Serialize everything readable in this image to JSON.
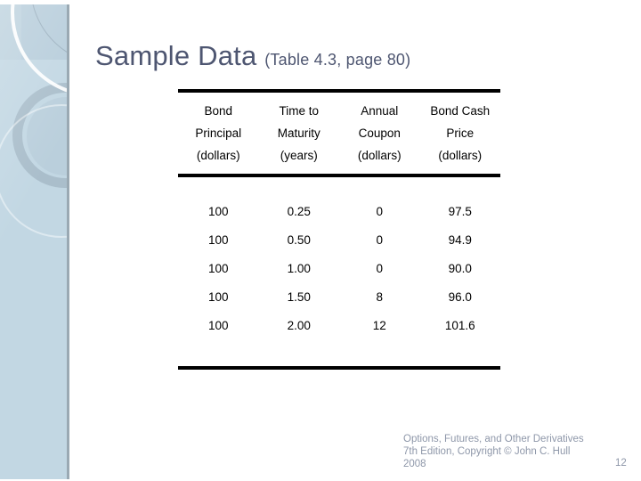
{
  "slide": {
    "title_main": "Sample Data ",
    "title_sub": "(Table 4.3, page 80)",
    "title_color": "#4e5671",
    "accent_sidebar_color": "#c2d7e3",
    "sidebar_border_color": "#9aa9b3"
  },
  "table": {
    "headers": [
      {
        "line1": "Bond",
        "line2": "Principal",
        "line3": "(dollars)"
      },
      {
        "line1": "Time to",
        "line2": "Maturity",
        "line3": "(years)"
      },
      {
        "line1": "Annual",
        "line2": "Coupon",
        "line3": "(dollars)"
      },
      {
        "line1": "Bond Cash",
        "line2": "Price",
        "line3": "(dollars)"
      }
    ],
    "rows": [
      [
        "100",
        "0.25",
        "0",
        "97.5"
      ],
      [
        "100",
        "0.50",
        "0",
        "94.9"
      ],
      [
        "100",
        "1.00",
        "0",
        "90.0"
      ],
      [
        "100",
        "1.50",
        "8",
        "96.0"
      ],
      [
        "100",
        "2.00",
        "12",
        "101.6"
      ]
    ]
  },
  "footer": {
    "credit": "Options, Futures, and Other Derivatives\n7th Edition, Copyright © John C. Hull\n2008",
    "page_number": "12",
    "color": "#8e97a9"
  }
}
